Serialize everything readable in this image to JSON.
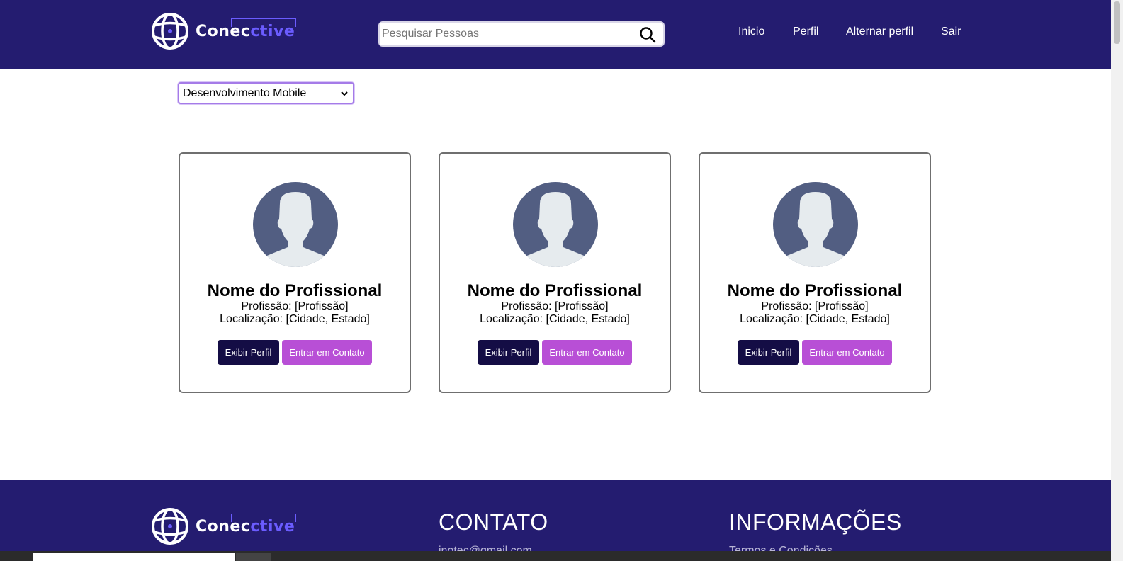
{
  "brand": {
    "name_start": "Conec",
    "name_accent": "ctive",
    "colors": {
      "header": "#241c70",
      "accent": "#6b5cff",
      "view_button": "#140d45",
      "contact_button": "#b84fd6"
    }
  },
  "search": {
    "placeholder": "Pesquisar Pessoas",
    "value": "",
    "icon": "search-icon"
  },
  "nav": {
    "items": [
      {
        "label": "Inicio"
      },
      {
        "label": "Perfil"
      },
      {
        "label": "Alternar perfil"
      },
      {
        "label": "Sair"
      }
    ]
  },
  "filter": {
    "selected": "Desenvolvimento Mobile"
  },
  "cards": [
    {
      "name": "Nome do Profissional",
      "profession": "Profissão: [Profissão]",
      "location": "Localização: [Cidade, Estado]",
      "view_label": "Exibir Perfil",
      "contact_label": "Entrar em Contato",
      "avatar_icon": "default-user-avatar"
    },
    {
      "name": "Nome do Profissional",
      "profession": "Profissão: [Profissão]",
      "location": "Localização: [Cidade, Estado]",
      "view_label": "Exibir Perfil",
      "contact_label": "Entrar em Contato",
      "avatar_icon": "default-user-avatar"
    },
    {
      "name": "Nome do Profissional",
      "profession": "Profissão: [Profissão]",
      "location": "Localização: [Cidade, Estado]",
      "view_label": "Exibir Perfil",
      "contact_label": "Entrar em Contato",
      "avatar_icon": "default-user-avatar"
    }
  ],
  "footer": {
    "contact_title": "CONTATO",
    "contact_email": "inotec@gmail.com",
    "info_title": "INFORMAÇÕES",
    "info_link": "Termos e Condições"
  }
}
